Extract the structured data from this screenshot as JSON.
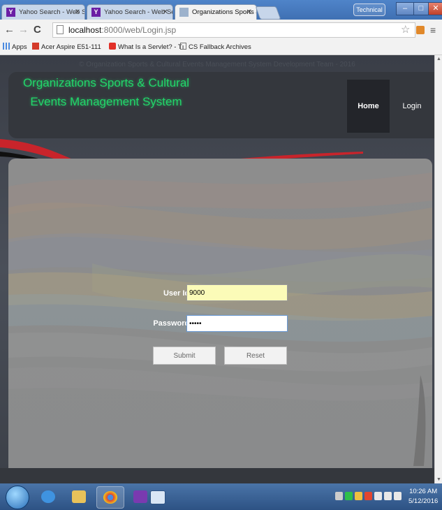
{
  "browser": {
    "tabs": [
      {
        "label": "Yahoo Search - Web Sear",
        "icon": "yahoo-icon",
        "active": false
      },
      {
        "label": "Yahoo Search - Web Sear",
        "icon": "yahoo-icon",
        "active": false
      },
      {
        "label": "Organizations Sports & C",
        "icon": "page-favicon",
        "active": true
      }
    ],
    "profile_label": "Technical",
    "url_host": "localhost",
    "url_path": ":8000/web/Login.jsp",
    "bookmarks": [
      {
        "label": "Apps",
        "icon": "apps-grid-icon"
      },
      {
        "label": "Acer Aspire E51-111",
        "icon": "sd-icon"
      },
      {
        "label": "What Is a Servlet? - Tı",
        "icon": "oracle-icon"
      },
      {
        "label": "CS Fallback Archives",
        "icon": "page-icon"
      }
    ]
  },
  "site": {
    "title_line1": "Organizations Sports & Cultural",
    "title_line2": "Events Management System",
    "nav": {
      "home": "Home",
      "login": "Login"
    },
    "form": {
      "user_id_label": "User Id :",
      "user_id_value": "9000",
      "password_label": "Password :",
      "password_value": "*****",
      "submit_label": "Submit",
      "reset_label": "Reset"
    },
    "footer": "© Organization Sports & Cultural Events Management System Development Team - 2016"
  },
  "taskbar": {
    "time": "10:26 AM",
    "date": "5/12/2016"
  },
  "colors": {
    "title_green": "#22d66a",
    "header_bg": "#34373d",
    "panel_gray": "#8d8d8d",
    "userid_fill": "#fbfbb8"
  }
}
